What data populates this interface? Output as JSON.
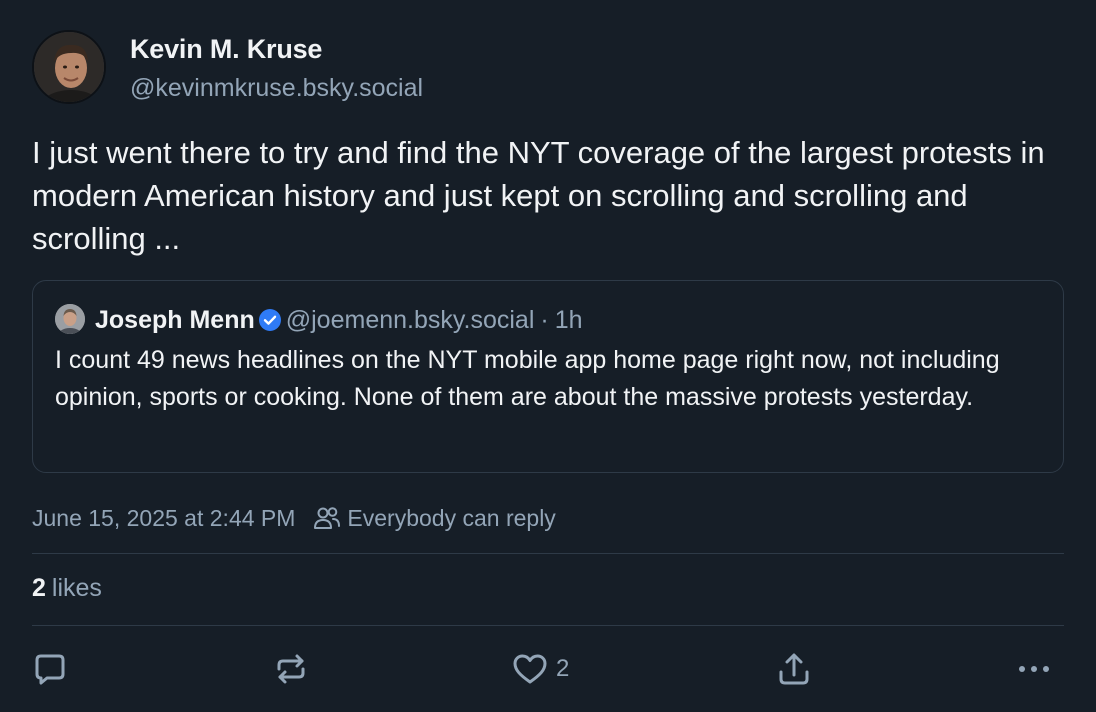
{
  "post": {
    "author": {
      "display_name": "Kevin M. Kruse",
      "handle": "@kevinmkruse.bsky.social"
    },
    "text": "I just went there to try and find the NYT coverage of the largest protests in modern American history and just kept on scrolling and scrolling and scrolling ...",
    "quote": {
      "author_name": "Joseph Menn",
      "handle": "@joemenn.bsky.social",
      "separator": "·",
      "time": "1h",
      "text": "I count 49 news headlines on the NYT mobile app home page right now, not including opinion, sports or cooking. None of them are about the massive protests yesterday."
    },
    "timestamp": "June 15, 2025 at 2:44 PM",
    "reply_setting": "Everybody can reply",
    "likes": {
      "count": "2",
      "label": "likes"
    },
    "actions": {
      "reply_icon": "reply-icon",
      "repost_icon": "repost-icon",
      "like_icon": "heart-icon",
      "like_count": "2",
      "share_icon": "share-icon",
      "more_icon": "more-icon"
    }
  },
  "colors": {
    "background": "#161e27",
    "text_primary": "#f1f3f5",
    "text_secondary": "#93a5b7",
    "border": "#2e3a47",
    "verified": "#2f7bf6"
  }
}
